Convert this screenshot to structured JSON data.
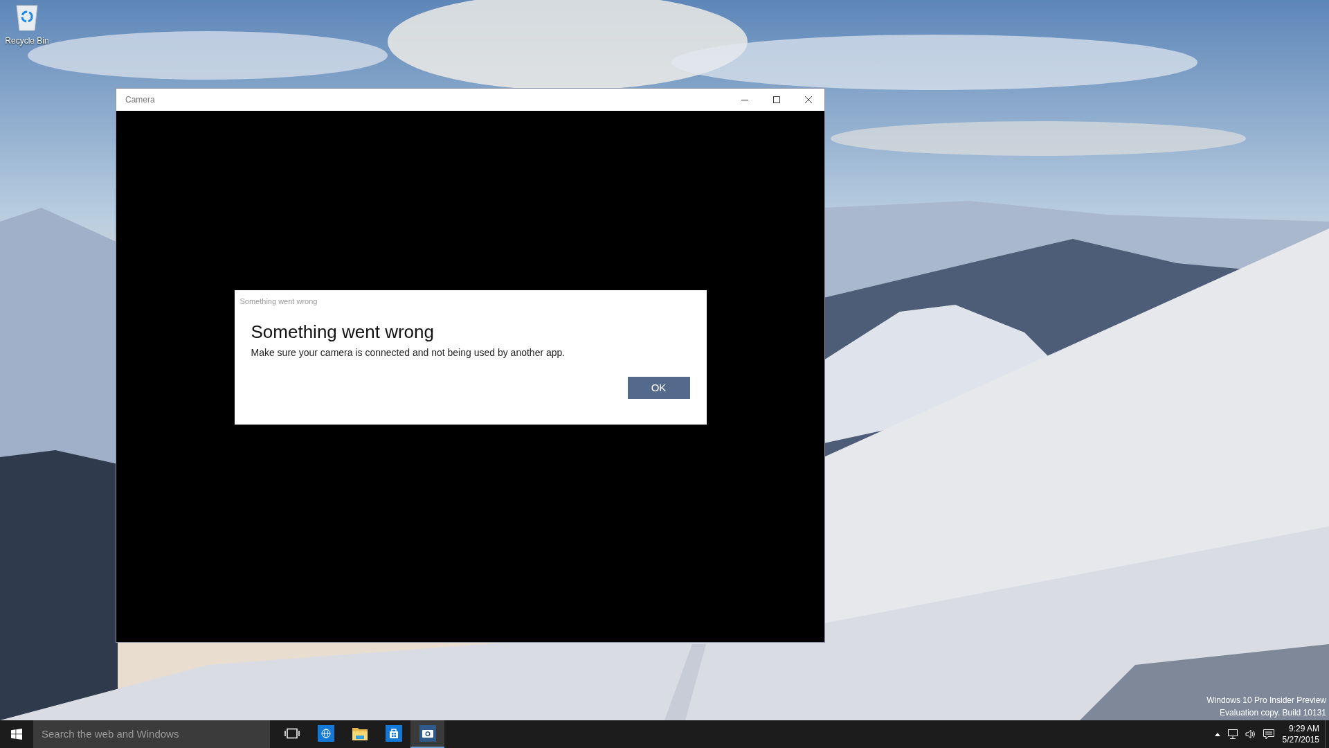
{
  "desktop": {
    "icons": [
      {
        "label": "Recycle Bin"
      }
    ],
    "watermark": [
      "Windows 10 Pro Insider Preview",
      "Evaluation copy. Build 10131"
    ]
  },
  "window": {
    "title": "Camera",
    "dialog": {
      "caption": "Something went wrong",
      "heading": "Something went wrong",
      "message": "Make sure your camera is connected and not being used by another app.",
      "buttons": [
        "OK"
      ]
    }
  },
  "taskbar": {
    "search": {
      "placeholder": "Search the web and Windows"
    },
    "apps": [
      {
        "kind": "task-view",
        "selected": false
      },
      {
        "kind": "browser",
        "selected": false
      },
      {
        "kind": "explorer",
        "selected": false
      },
      {
        "kind": "store",
        "selected": false
      },
      {
        "kind": "camera",
        "selected": true
      }
    ],
    "tray": {
      "time": "9:29 AM",
      "date": "5/27/2015"
    }
  }
}
